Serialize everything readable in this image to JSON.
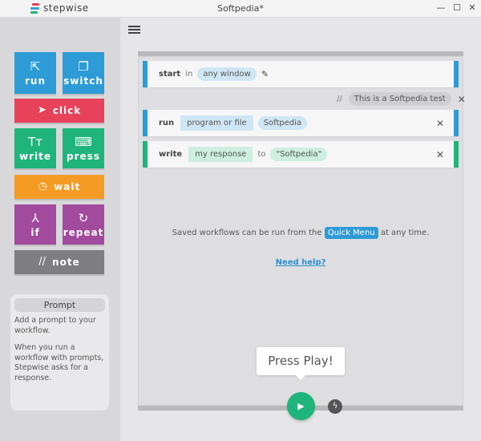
{
  "app": {
    "brand": "stepwise",
    "window_title": "Softpedia*"
  },
  "window_controls": {
    "minimize": "—",
    "maximize": "☐",
    "close": "✕"
  },
  "palette": {
    "run": {
      "label": "run",
      "icon": "external-link-icon",
      "glyph": "⇱",
      "color": "#2d9bd6"
    },
    "switch": {
      "label": "switch",
      "icon": "windows-icon",
      "glyph": "❐",
      "color": "#2d9bd6"
    },
    "click": {
      "label": "click",
      "icon": "cursor-arrow-icon",
      "glyph": "➤",
      "color": "#e8415a"
    },
    "write": {
      "label": "write",
      "icon": "text-icon",
      "glyph": "Tт",
      "color": "#1fb47b"
    },
    "press": {
      "label": "press",
      "icon": "keyboard-icon",
      "glyph": "⌨",
      "color": "#1fb47b"
    },
    "wait": {
      "label": "wait",
      "icon": "stopwatch-icon",
      "glyph": "◷",
      "color": "#f59a23"
    },
    "if": {
      "label": "if",
      "icon": "branch-icon",
      "glyph": "⅄",
      "color": "#a24a9e"
    },
    "repeat": {
      "label": "repeat",
      "icon": "repeat-icon",
      "glyph": "↻",
      "color": "#a24a9e"
    },
    "note": {
      "label": "note",
      "icon": "comment-slashes-icon",
      "glyph": "//",
      "color": "#7e7e82"
    }
  },
  "prompt_panel": {
    "title": "Prompt",
    "text1": "Add a prompt to your workflow.",
    "text2": "When you run a workflow with prompts, Stepwise asks for a response."
  },
  "workflow": {
    "step_start": {
      "keyword": "start",
      "in": "in",
      "target": "any window"
    },
    "note": {
      "prefix": "//",
      "text": "This is a Softpedia test"
    },
    "step_run": {
      "keyword": "run",
      "kind": "program or file",
      "target": "Softpedia"
    },
    "step_write": {
      "keyword": "write",
      "what": "my response",
      "to": "to",
      "target": "\"Softpedia\""
    }
  },
  "message": {
    "before": "Saved workflows can be run from the",
    "link": "Quick Menu",
    "after": "at any time."
  },
  "help_link": "Need help?",
  "press_play": "Press Play!",
  "close_glyph": "✕"
}
